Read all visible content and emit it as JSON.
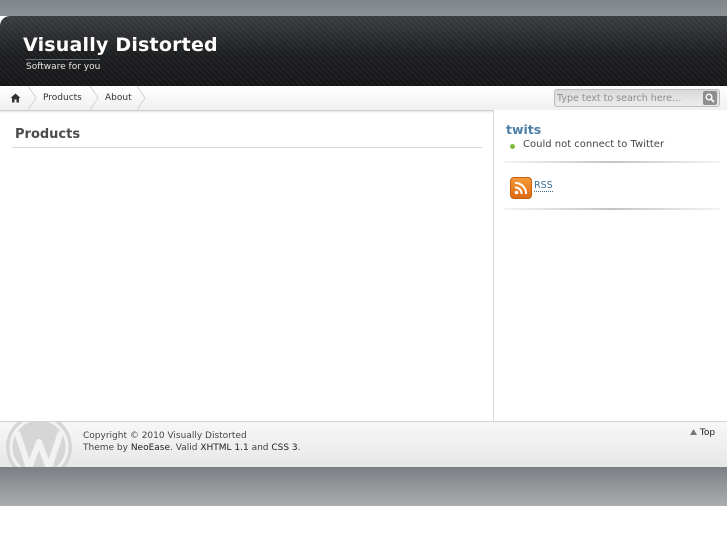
{
  "site": {
    "title": "Visually Distorted",
    "description": "Software for you"
  },
  "nav": {
    "items": [
      {
        "label": "Products"
      },
      {
        "label": "About"
      }
    ]
  },
  "search": {
    "placeholder": "Type text to search here..."
  },
  "content": {
    "title": "Products"
  },
  "sidebar": {
    "twits_title": "twits",
    "twits_message": "Could not connect to Twitter",
    "rss_label": "RSS"
  },
  "footer": {
    "copyright": "Copyright © 2010 Visually Distorted",
    "theme_by": "Theme by ",
    "theme_author": "NeoEase",
    "valid_text": ". Valid ",
    "xhtml_link": "XHTML 1.1",
    "and_text": " and ",
    "css_link": "CSS 3",
    "end_text": ".",
    "top_label": "Top"
  },
  "icons": {
    "home": "home-icon",
    "search": "search-icon",
    "rss": "rss-icon",
    "wordpress": "wordpress-logo-icon",
    "top_arrow": "arrow-up-icon"
  },
  "colors": {
    "header_bg": "#1c1d1f",
    "link": "#3e6f98",
    "twits_title": "#4d7fa6",
    "bullet": "#7cbb3a",
    "rss": "#e8781f"
  }
}
